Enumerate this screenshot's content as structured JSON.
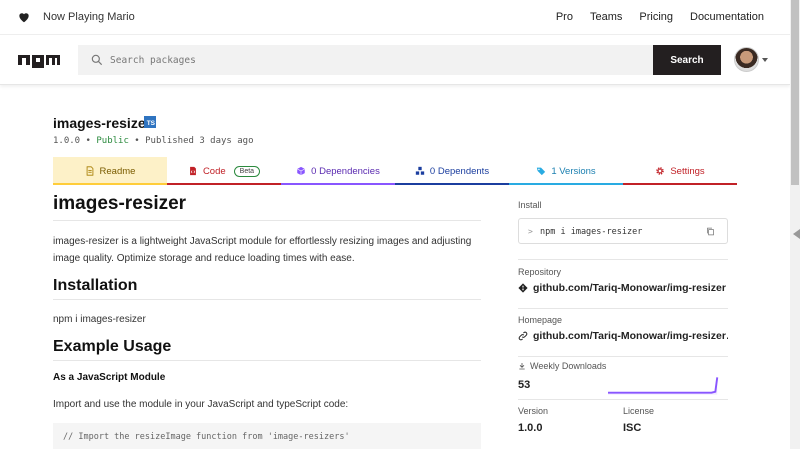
{
  "topbar": {
    "now_playing": "Now Playing Mario",
    "nav": [
      "Pro",
      "Teams",
      "Pricing",
      "Documentation"
    ]
  },
  "search": {
    "placeholder": "Search packages",
    "button": "Search"
  },
  "package": {
    "name": "images-resizer",
    "ts_badge": "TS",
    "version": "1.0.0",
    "visibility": "Public",
    "published": "Published 3 days ago"
  },
  "tabs": [
    {
      "label": "Readme",
      "color": "#ffcd3a"
    },
    {
      "label": "Code",
      "badge": "Beta",
      "color": "#c12127"
    },
    {
      "label": "0 Dependencies",
      "color": "#8956ff"
    },
    {
      "label": "0 Dependents",
      "color": "#1b3e9f"
    },
    {
      "label": "1 Versions",
      "color": "#29abe2"
    },
    {
      "label": "Settings",
      "color": "#c12127"
    }
  ],
  "readme": {
    "title": "images-resizer",
    "intro": "images-resizer is a lightweight JavaScript module for effortlessly resizing images and adjusting image quality. Optimize storage and reduce loading times with ease.",
    "installation_heading": "Installation",
    "install_cmd": "npm i images-resizer",
    "usage_heading": "Example Usage",
    "module_heading": "As a JavaScript Module",
    "import_text": "Import and use the module in your JavaScript and typeScript code:",
    "code_line": "// Import the resizeImage function from 'image-resizers'"
  },
  "sidebar": {
    "install_label": "Install",
    "install_prompt": ">",
    "install_cmd": "npm i images-resizer",
    "repository_label": "Repository",
    "repository": "github.com/Tariq-Monowar/img-resizer",
    "homepage_label": "Homepage",
    "homepage": "github.com/Tariq-Monowar/img-resizer…",
    "downloads_label": "Weekly Downloads",
    "downloads": "53",
    "version_label": "Version",
    "version": "1.0.0",
    "license_label": "License",
    "license": "ISC"
  },
  "colors": {
    "sparkline": "#8956ff",
    "public": "#2b8a3e",
    "ts": "#2f74c0"
  }
}
